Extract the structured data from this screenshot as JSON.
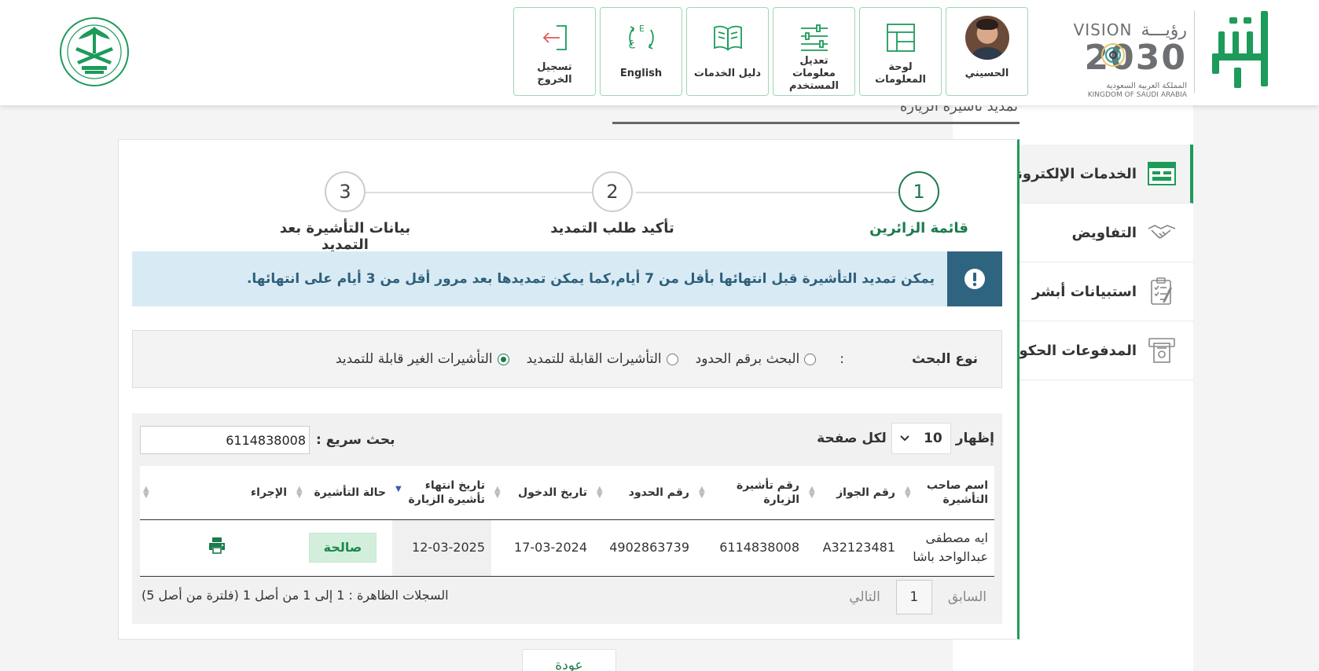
{
  "header": {
    "brand": {
      "absher_logo": "absher-logo",
      "vision_logo": {
        "line1_en": "VISION",
        "line1_ar": "رؤيـــة",
        "year": "2030",
        "line3_ar": "المملكة العربية السعودية",
        "line4_en": "KINGDOM OF SAUDI ARABIA"
      },
      "moi_logo": "ministry-of-interior-emblem"
    },
    "tiles": [
      {
        "name": "profile",
        "label": "الحسيني",
        "icon": "avatar"
      },
      {
        "name": "dashboard",
        "label": "لوحة المعلومات",
        "icon": "dashboard-icon"
      },
      {
        "name": "edit-user-info",
        "label": "تعديل معلومات المستخدم",
        "icon": "sliders-icon"
      },
      {
        "name": "services-guide",
        "label": "دليل الخدمات",
        "icon": "book-icon"
      },
      {
        "name": "language",
        "label": "English",
        "icon": "language-icon"
      },
      {
        "name": "logout",
        "label": "تسجيل الخروج",
        "icon": "logout-icon"
      }
    ]
  },
  "sidebar": {
    "items": [
      {
        "label": "الخدمات الإلكترونية",
        "icon": "e-services-icon",
        "active": true
      },
      {
        "label": "التفاويض",
        "icon": "handshake-icon",
        "active": false
      },
      {
        "label": "استبيانات أبشر",
        "icon": "survey-icon",
        "active": false
      },
      {
        "label": "المدفوعات الحكومية",
        "icon": "payments-icon",
        "active": false
      }
    ]
  },
  "page": {
    "title": "تمديد تأشيرة الزيارة",
    "steps": [
      {
        "number": "1",
        "label": "قائمة الزائرين",
        "active": true
      },
      {
        "number": "2",
        "label": "تأكيد طلب التمديد",
        "active": false
      },
      {
        "number": "3",
        "label": "بيانات التأشيرة بعد التمديد",
        "active": false
      }
    ],
    "notice": "يمكن تمديد التأشيرة قبل انتهائها بأقل من 7 أيام,كما يمكن تمديدها بعد مرور أقل من 3 أيام على انتهائها.",
    "search_type": {
      "label": "نوع البحث",
      "colon": ":",
      "options": [
        {
          "label": "البحث برقم الحدود",
          "checked": false
        },
        {
          "label": "التأشيرات القابلة للتمديد",
          "checked": false
        },
        {
          "label": "التأشيرات الغير قابلة للتمديد",
          "checked": true
        }
      ]
    },
    "table_controls": {
      "show_label": "إظهار",
      "page_size": "10",
      "per_page_label": "لكل صفحة",
      "quick_search_label": "بحث سريع :",
      "quick_search_value": "6114838008"
    },
    "table": {
      "columns": [
        "اسم صاحب التأشيرة",
        "رقم الجواز",
        "رقم تأشيرة الزيارة",
        "رقم الحدود",
        "تاريخ الدخول",
        "تاريخ انتهاء تأشيرة الزيارة",
        "حالة التأشيرة",
        "الإجراء"
      ],
      "rows": [
        {
          "name": "ايه مصطفى عبدالواحد باشا",
          "passport": "A32123481",
          "visa_number": "6114838008",
          "border_number": "4902863739",
          "entry_date": "17-03-2024",
          "expiry_date": "12-03-2025",
          "status": "صالحة",
          "action_icon": "print-icon"
        }
      ]
    },
    "pagination": {
      "prev": "السابق",
      "current": "1",
      "next": "التالي",
      "records_info": "السجلات الظاهرة : 1 إلى 1 من أصل 1 (فلترة من أصل 5)"
    },
    "back_button": "عودة"
  },
  "colors": {
    "brand_green": "#1d7a4c",
    "accent_green": "#1d9b5a",
    "notice_bg": "#d8ebf5",
    "notice_icon_bg": "#2f6480",
    "status_badge_bg": "#d3efdc"
  }
}
